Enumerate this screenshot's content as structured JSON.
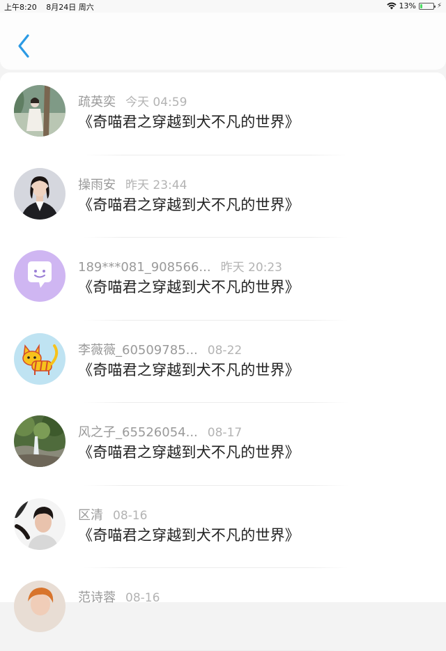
{
  "status_bar": {
    "time": "上午8:20",
    "date": "8月24日 周六",
    "battery_percent": "13%",
    "battery_level": 0.13
  },
  "comments": [
    {
      "name": "疏英奕",
      "time": "今天 04:59",
      "content": "《奇喵君之穿越到犬不凡的世界》",
      "avatar": "photo-girl-tree"
    },
    {
      "name": "操雨安",
      "time": "昨天 23:44",
      "content": "《奇喵君之穿越到犬不凡的世界》",
      "avatar": "photo-woman-suit"
    },
    {
      "name": "189***081_908566...",
      "time": "昨天 20:23",
      "content": "《奇喵君之穿越到犬不凡的世界》",
      "avatar": "chat-bubble-purple"
    },
    {
      "name": "李薇薇_60509785...",
      "time": "08-22",
      "content": "《奇喵君之穿越到犬不凡的世界》",
      "avatar": "cartoon-cat"
    },
    {
      "name": "风之子_65526054...",
      "time": "08-17",
      "content": "《奇喵君之穿越到犬不凡的世界》",
      "avatar": "photo-waterfall"
    },
    {
      "name": "区清",
      "time": "08-16",
      "content": "《奇喵君之穿越到犬不凡的世界》",
      "avatar": "photo-young-man"
    },
    {
      "name": "范诗蓉",
      "time": "08-16",
      "content": "",
      "avatar": "photo-partial"
    }
  ]
}
